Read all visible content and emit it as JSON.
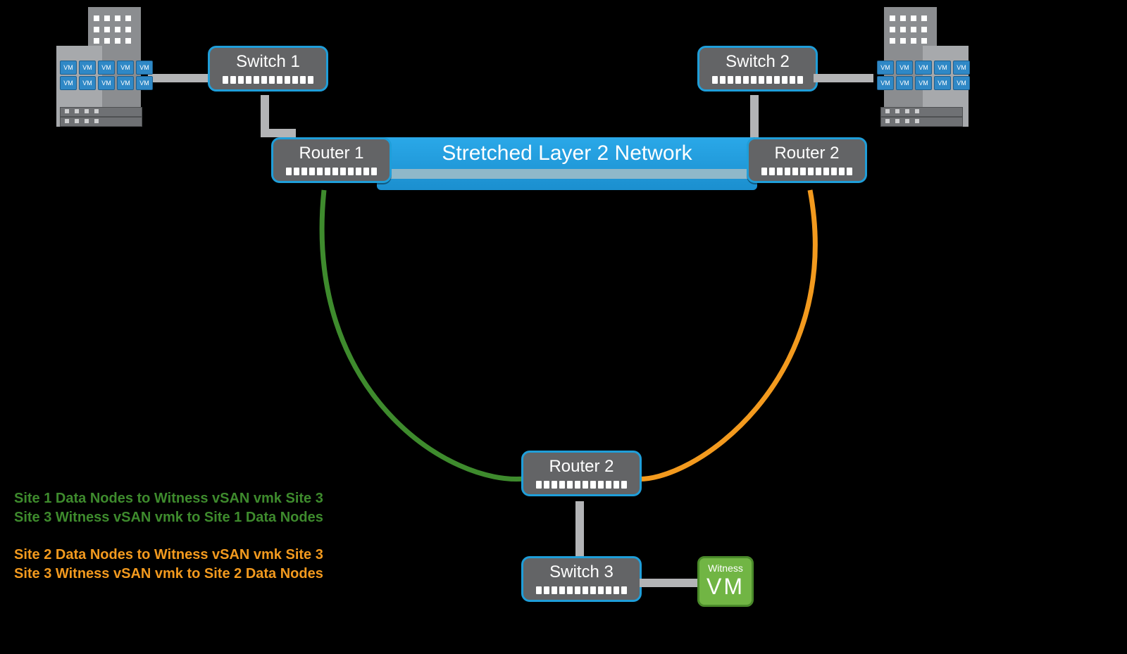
{
  "devices": {
    "switch1": "Switch 1",
    "switch2": "Switch 2",
    "switch3": "Switch 3",
    "router1": "Router 1",
    "router2_top": "Router 2",
    "router2_bottom": "Router 2"
  },
  "l2": {
    "label": "Stretched Layer 2 Network"
  },
  "witness": {
    "small": "Witness",
    "big": "VM"
  },
  "legend": {
    "g1": "Site 1 Data Nodes to Witness vSAN vmk Site 3",
    "g2": "Site 3 Witness vSAN vmk to Site 1 Data Nodes",
    "o1": "Site 2 Data Nodes to Witness vSAN vmk Site 3",
    "o2": "Site 3 Witness vSAN vmk to Site 2 Data Nodes"
  },
  "vm_label": "VM",
  "topology": {
    "sites": [
      "Site 1 (left datacenter)",
      "Site 2 (right datacenter)",
      "Site 3 (witness)"
    ],
    "links": [
      {
        "from": "Site 1 building",
        "to": "Switch 1",
        "type": "grey-eth"
      },
      {
        "from": "Switch 1",
        "to": "Router 1",
        "type": "grey-eth"
      },
      {
        "from": "Site 2 building",
        "to": "Switch 2",
        "type": "grey-eth"
      },
      {
        "from": "Switch 2",
        "to": "Router 2 (top)",
        "type": "grey-eth"
      },
      {
        "from": "Router 1",
        "to": "Router 2 (top)",
        "type": "stretched-L2"
      },
      {
        "from": "Router 1",
        "to": "Router 2 (bottom)",
        "type": "green-curve"
      },
      {
        "from": "Router 2 (top)",
        "to": "Router 2 (bottom)",
        "type": "orange-curve"
      },
      {
        "from": "Router 2 (bottom)",
        "to": "Switch 3",
        "type": "grey-eth"
      },
      {
        "from": "Switch 3",
        "to": "Witness VM",
        "type": "grey-eth"
      }
    ]
  },
  "colors": {
    "device_fill": "#636466",
    "device_border": "#1f9ed9",
    "l2_blue": "#1e9bd7",
    "green_path": "#3e8b2d",
    "orange_path": "#f39a1e",
    "witness_green": "#71b544",
    "connector_grey": "#b3b4b6"
  }
}
